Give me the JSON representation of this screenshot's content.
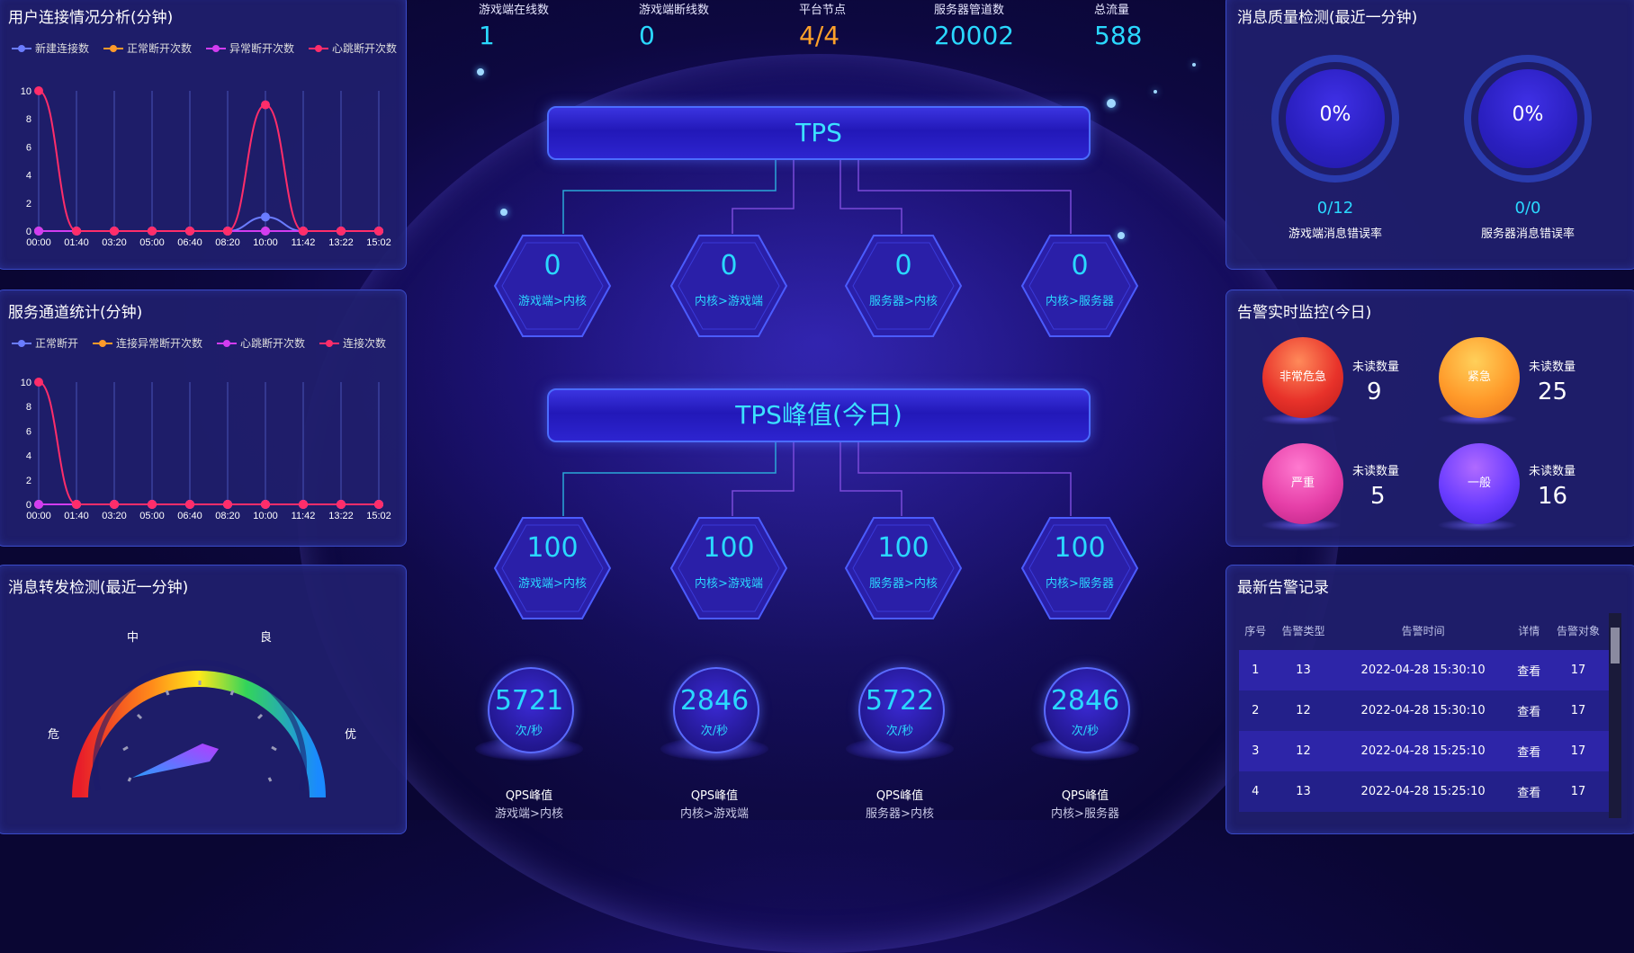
{
  "top_stats": [
    {
      "label": "游戏端在线数",
      "value": "1",
      "color": "#2ad8ff"
    },
    {
      "label": "游戏端断线数",
      "value": "0",
      "color": "#2ad8ff"
    },
    {
      "label": "平台节点",
      "value": "4/4",
      "color": "#ffa12a"
    },
    {
      "label": "服务器管道数",
      "value": "20002",
      "color": "#2ad8ff"
    },
    {
      "label": "总流量",
      "value": "588",
      "color": "#2ad8ff"
    }
  ],
  "user_conn": {
    "title": "用户连接情况分析(分钟)",
    "legend": [
      "新建连接数",
      "正常断开次数",
      "异常断开次数",
      "心跳断开次数"
    ]
  },
  "service_channel": {
    "title": "服务通道统计(分钟)",
    "legend": [
      "正常断开",
      "连接异常断开次数",
      "心跳断开次数",
      "连接次数"
    ]
  },
  "forward": {
    "title": "消息转发检测(最近一分钟)",
    "labels": {
      "danger": "危",
      "mid": "中",
      "good": "良",
      "excellent": "优"
    }
  },
  "tps": {
    "title": "TPS",
    "items": [
      {
        "value": "0",
        "label": "游戏端>内核"
      },
      {
        "value": "0",
        "label": "内核>游戏端"
      },
      {
        "value": "0",
        "label": "服务器>内核"
      },
      {
        "value": "0",
        "label": "内核>服务器"
      }
    ]
  },
  "tps_peak": {
    "title": "TPS峰值(今日)",
    "items": [
      {
        "value": "100",
        "label": "游戏端>内核"
      },
      {
        "value": "100",
        "label": "内核>游戏端"
      },
      {
        "value": "100",
        "label": "服务器>内核"
      },
      {
        "value": "100",
        "label": "内核>服务器"
      }
    ]
  },
  "qps": [
    {
      "value": "5721",
      "unit": "次/秒",
      "caption": "QPS峰值",
      "sub": "游戏端>内核"
    },
    {
      "value": "2846",
      "unit": "次/秒",
      "caption": "QPS峰值",
      "sub": "内核>游戏端"
    },
    {
      "value": "5722",
      "unit": "次/秒",
      "caption": "QPS峰值",
      "sub": "服务器>内核"
    },
    {
      "value": "2846",
      "unit": "次/秒",
      "caption": "QPS峰值",
      "sub": "内核>服务器"
    }
  ],
  "quality": {
    "title": "消息质量检测(最近一分钟)",
    "items": [
      {
        "percent": "0%",
        "ratio": "0/12",
        "label": "游戏端消息错误率"
      },
      {
        "percent": "0%",
        "ratio": "0/0",
        "label": "服务器消息错误率"
      }
    ]
  },
  "alarm": {
    "title": "告警实时监控(今日)",
    "items": [
      {
        "name": "非常危急",
        "caption": "未读数量",
        "count": "9",
        "color": "#e8322a"
      },
      {
        "name": "紧急",
        "caption": "未读数量",
        "count": "25",
        "color": "#ff9a2a"
      },
      {
        "name": "严重",
        "caption": "未读数量",
        "count": "5",
        "color": "#e63fa8"
      },
      {
        "name": "一般",
        "caption": "未读数量",
        "count": "16",
        "color": "#6a3cff"
      }
    ]
  },
  "records": {
    "title": "最新告警记录",
    "headers": [
      "序号",
      "告警类型",
      "告警时间",
      "详情",
      "告警对象"
    ],
    "rows": [
      {
        "no": "1",
        "type": "13",
        "time": "2022-04-28 15:30:10",
        "detail": "查看",
        "target": "17"
      },
      {
        "no": "2",
        "type": "12",
        "time": "2022-04-28 15:30:10",
        "detail": "查看",
        "target": "17"
      },
      {
        "no": "3",
        "type": "12",
        "time": "2022-04-28 15:25:10",
        "detail": "查看",
        "target": "17"
      },
      {
        "no": "4",
        "type": "13",
        "time": "2022-04-28 15:25:10",
        "detail": "查看",
        "target": "17"
      }
    ]
  },
  "chart_data": [
    {
      "type": "line",
      "title": "用户连接情况分析(分钟)",
      "categories": [
        "00:00",
        "01:40",
        "03:20",
        "05:00",
        "06:40",
        "08:20",
        "10:00",
        "11:42",
        "13:22",
        "15:02"
      ],
      "ylim": [
        0,
        10
      ],
      "yticks": [
        0,
        2,
        4,
        6,
        8,
        10
      ],
      "series": [
        {
          "name": "新建连接数",
          "color": "#6a7cff",
          "values": [
            0,
            0,
            0,
            0,
            0,
            0,
            1,
            0,
            0,
            0
          ]
        },
        {
          "name": "正常断开次数",
          "color": "#ff9a2a",
          "values": [
            0,
            0,
            0,
            0,
            0,
            0,
            0,
            0,
            0,
            0
          ]
        },
        {
          "name": "异常断开次数",
          "color": "#d23cf0",
          "values": [
            0,
            0,
            0,
            0,
            0,
            0,
            0,
            0,
            0,
            0
          ]
        },
        {
          "name": "心跳断开次数",
          "color": "#ff2d6a",
          "values": [
            10,
            0,
            0,
            0,
            0,
            0,
            9,
            0,
            0,
            0
          ]
        }
      ]
    },
    {
      "type": "line",
      "title": "服务通道统计(分钟)",
      "categories": [
        "00:00",
        "01:40",
        "03:20",
        "05:00",
        "06:40",
        "08:20",
        "10:00",
        "11:42",
        "13:22",
        "15:02"
      ],
      "ylim": [
        0,
        10
      ],
      "yticks": [
        0,
        2,
        4,
        6,
        8,
        10
      ],
      "series": [
        {
          "name": "正常断开",
          "color": "#6a7cff",
          "values": [
            0,
            0,
            0,
            0,
            0,
            0,
            0,
            0,
            0,
            0
          ]
        },
        {
          "name": "连接异常断开次数",
          "color": "#ff9a2a",
          "values": [
            0,
            0,
            0,
            0,
            0,
            0,
            0,
            0,
            0,
            0
          ]
        },
        {
          "name": "心跳断开次数",
          "color": "#d23cf0",
          "values": [
            0,
            0,
            0,
            0,
            0,
            0,
            0,
            0,
            0,
            0
          ]
        },
        {
          "name": "连接次数",
          "color": "#ff2d6a",
          "values": [
            10,
            0,
            0,
            0,
            0,
            0,
            0,
            0,
            0,
            0
          ]
        }
      ]
    }
  ]
}
